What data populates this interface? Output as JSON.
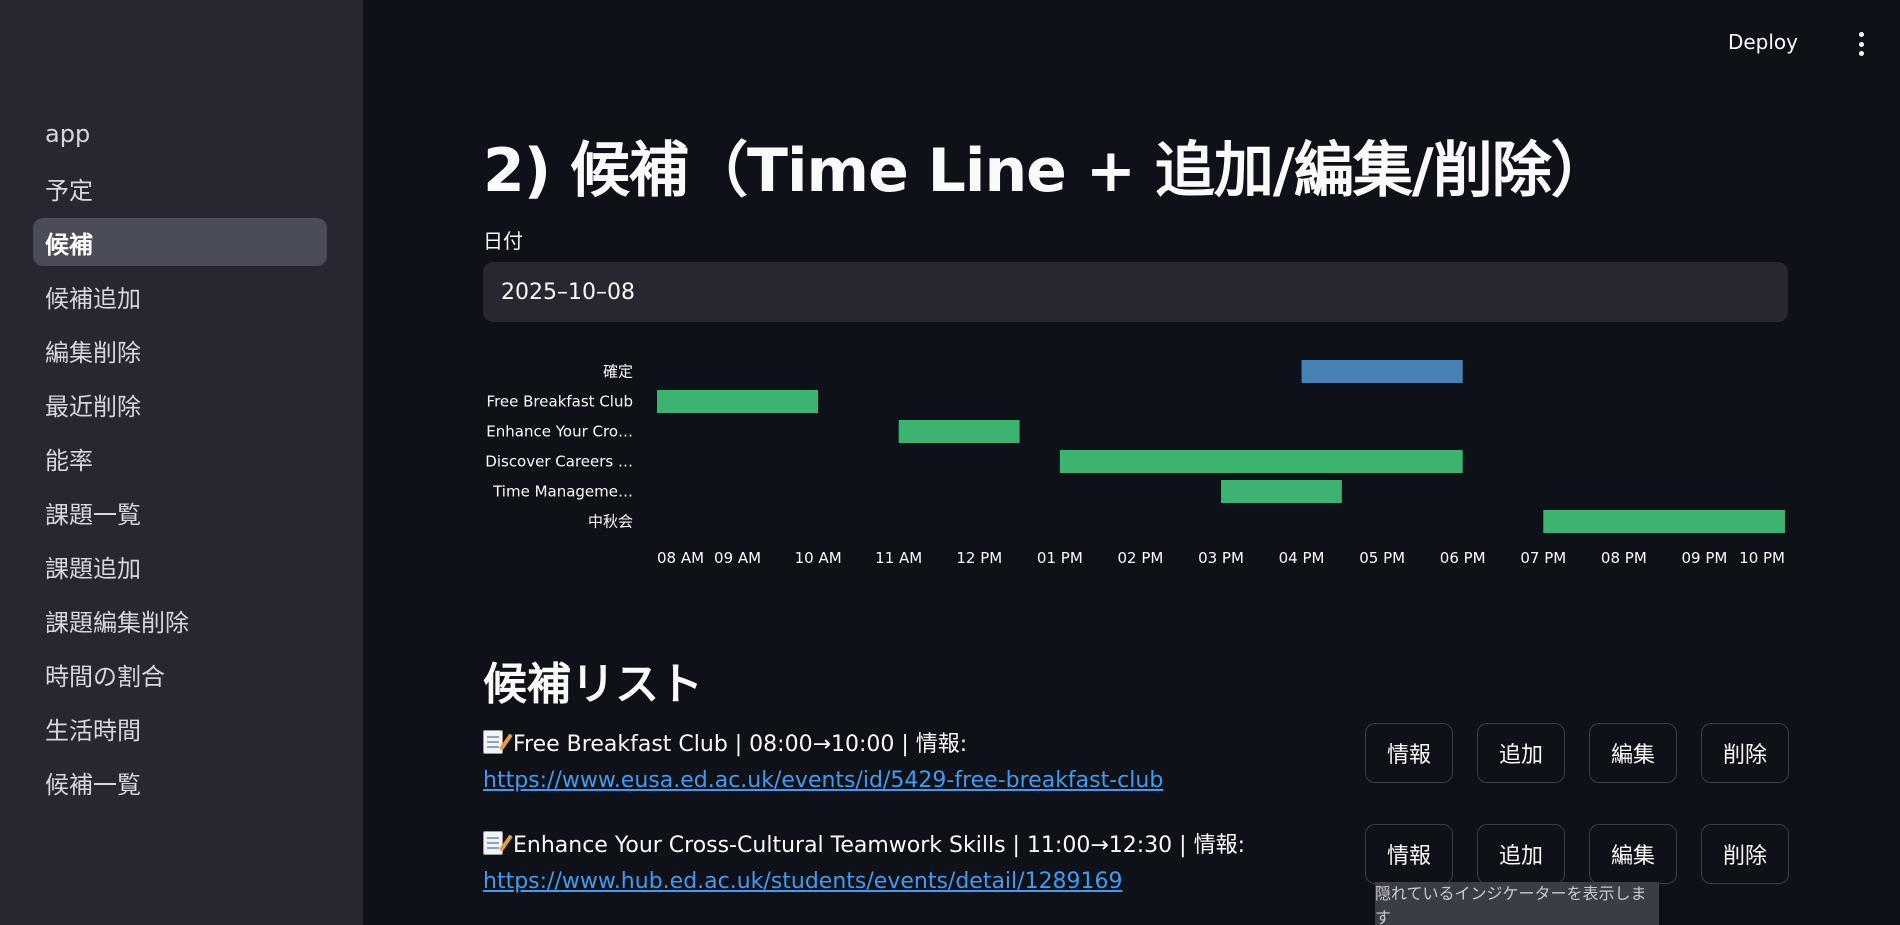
{
  "sidebar": {
    "items": [
      {
        "label": "app"
      },
      {
        "label": "予定"
      },
      {
        "label": "候補",
        "active": true
      },
      {
        "label": "候補追加"
      },
      {
        "label": "編集削除"
      },
      {
        "label": "最近削除"
      },
      {
        "label": "能率"
      },
      {
        "label": "課題一覧"
      },
      {
        "label": "課題追加"
      },
      {
        "label": "課題編集削除"
      },
      {
        "label": "時間の割合"
      },
      {
        "label": "生活時間"
      },
      {
        "label": "候補一覧"
      }
    ]
  },
  "header": {
    "deploy_label": "Deploy",
    "menu_icon": "kebab-menu-icon"
  },
  "page": {
    "title": "2) 候補（Time Line + 追加/編集/削除）",
    "date_label": "日付",
    "date_value": "2025–10–08",
    "list_title": "候補リスト"
  },
  "chart_data": {
    "type": "bar",
    "orientation": "horizontal-timeline",
    "rows": [
      "確定",
      "Free Breakfast Club",
      "Enhance Your Cro…",
      "Discover Careers …",
      "Time Manageme…",
      "中秋会"
    ],
    "x_ticks": [
      "08 AM",
      "09 AM",
      "10 AM",
      "11 AM",
      "12 PM",
      "01 PM",
      "02 PM",
      "03 PM",
      "04 PM",
      "05 PM",
      "06 PM",
      "07 PM",
      "08 PM",
      "09 PM",
      "10 PM"
    ],
    "xlim": [
      "08:00",
      "22:00"
    ],
    "series": [
      {
        "row": "確定",
        "start": "16:00",
        "end": "18:00",
        "color": "#4682b4"
      },
      {
        "row": "Free Breakfast Club",
        "start": "08:00",
        "end": "10:00",
        "color": "#3cb371"
      },
      {
        "row": "Enhance Your Cro…",
        "start": "11:00",
        "end": "12:30",
        "color": "#3cb371"
      },
      {
        "row": "Discover Careers …",
        "start": "13:00",
        "end": "18:00",
        "color": "#3cb371"
      },
      {
        "row": "Time Manageme…",
        "start": "15:00",
        "end": "16:30",
        "color": "#3cb371"
      },
      {
        "row": "中秋会",
        "start": "19:00",
        "end": "22:00",
        "color": "#3cb371"
      }
    ]
  },
  "candidates": [
    {
      "text": "Free Breakfast Club | 08:00→10:00 | 情報:",
      "url": "https://www.eusa.ed.ac.uk/events/id/5429-free-breakfast-club"
    },
    {
      "text": "Enhance Your Cross-Cultural Teamwork Skills | 11:00→12:30 | 情報:",
      "url": "https://www.hub.ed.ac.uk/students/events/detail/1289169"
    }
  ],
  "actions": {
    "info": "情報",
    "add": "追加",
    "edit": "編集",
    "delete": "削除"
  },
  "tooltip": "隠れているインジケーターを表示します"
}
